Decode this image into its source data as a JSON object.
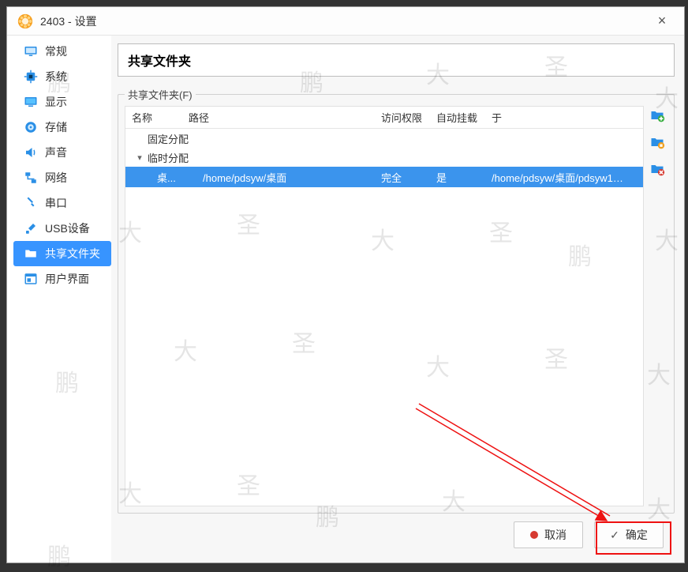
{
  "window": {
    "title": "2403 - 设置"
  },
  "sidebar": {
    "items": [
      {
        "label": "常规"
      },
      {
        "label": "系统"
      },
      {
        "label": "显示"
      },
      {
        "label": "存储"
      },
      {
        "label": "声音"
      },
      {
        "label": "网络"
      },
      {
        "label": "串口"
      },
      {
        "label": "USB设备"
      },
      {
        "label": "共享文件夹"
      },
      {
        "label": "用户界面"
      }
    ],
    "active_index": 8
  },
  "main": {
    "heading": "共享文件夹",
    "legend": "共享文件夹(F)",
    "columns": {
      "name": "名称",
      "path": "路径",
      "access": "访问权限",
      "mount": "自动挂载",
      "at": "于"
    },
    "groups": [
      {
        "label": "固定分配",
        "expandable": false
      },
      {
        "label": "临时分配",
        "expandable": true,
        "expanded": true
      }
    ],
    "rows": [
      {
        "name": "桌...",
        "path": "/home/pdsyw/桌面",
        "access": "完全",
        "mount": "是",
        "at": "/home/pdsyw/桌面/pdsyw1…",
        "selected": true
      }
    ]
  },
  "footer": {
    "cancel": "取消",
    "ok": "确定"
  },
  "icons": {
    "app": "gear",
    "close": "×"
  }
}
